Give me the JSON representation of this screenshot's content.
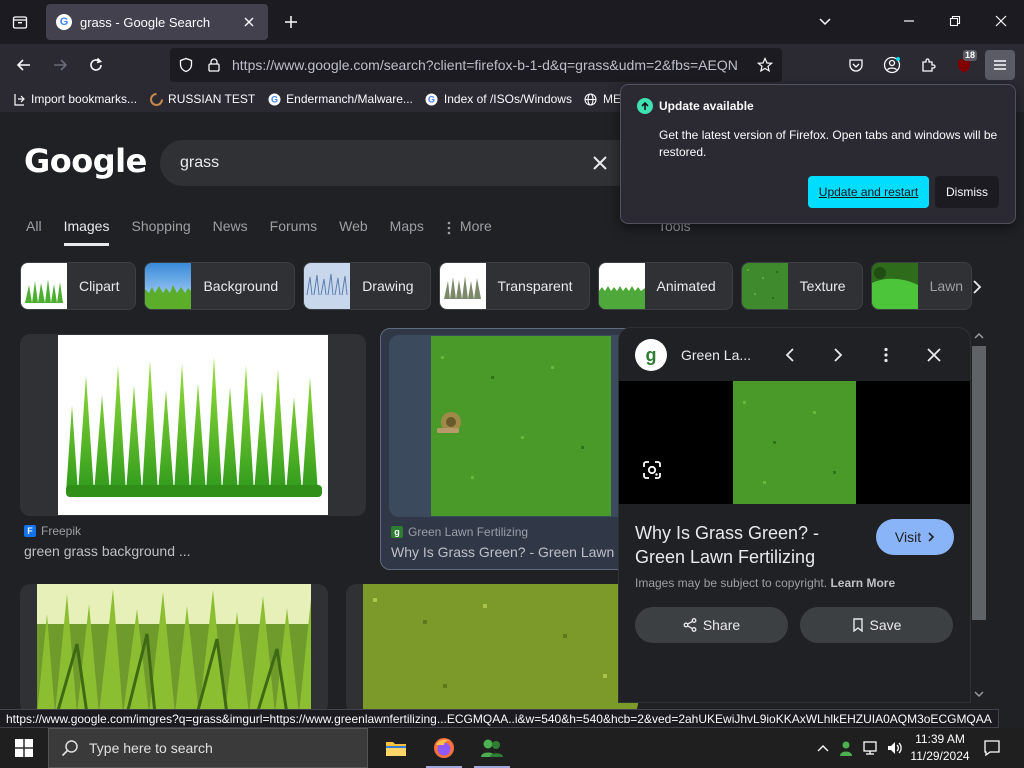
{
  "browser": {
    "tab_title": "grass - Google Search",
    "url_host": "https://www.google.com",
    "url_rest": "/search?client=firefox-b-1-d&q=grass&udm=2&fbs=AEQN",
    "notif_badge": "18"
  },
  "bookmarks": [
    {
      "label": "Import bookmarks..."
    },
    {
      "label": "RUSSIAN TEST"
    },
    {
      "label": "Endermanch/Malware..."
    },
    {
      "label": "Index of /ISOs/Windows"
    },
    {
      "label": "MEN"
    }
  ],
  "google": {
    "logo": "Google",
    "query": "grass",
    "tabs": [
      "All",
      "Images",
      "Shopping",
      "News",
      "Forums",
      "Web",
      "Maps",
      "More"
    ],
    "tools": "Tools",
    "chips": [
      "Clipart",
      "Background",
      "Drawing",
      "Transparent",
      "Animated",
      "Texture",
      "Lawn"
    ]
  },
  "results": [
    {
      "source": "Freepik",
      "title": "green grass background ..."
    },
    {
      "source": "Green Lawn Fertilizing",
      "title": "Why Is Grass Green? - Green Lawn"
    }
  ],
  "preview": {
    "site": "Green La...",
    "logo_letter": "g",
    "title": "Why Is Grass Green? - Green Lawn Fertilizing",
    "visit": "Visit",
    "copyright": "Images may be subject to copyright.",
    "learn_more": "Learn More",
    "share": "Share",
    "save": "Save"
  },
  "popup": {
    "title": "Update available",
    "body": "Get the latest version of Firefox. Open tabs and windows will be restored.",
    "primary": "Update and restart",
    "secondary": "Dismiss"
  },
  "status_url": "https://www.google.com/imgres?q=grass&imgurl=https://www.greenlawnfertilizing...ECGMQAA..i&w=540&h=540&hcb=2&ved=2ahUKEwiJhvL9ioKKAxWLhlkEHZUIA0AQM3oECGMQAA",
  "taskbar": {
    "search_placeholder": "Type here to search",
    "time": "11:39 AM",
    "date": "11/29/2024"
  },
  "colors": {
    "accent": "#8ab4f8",
    "firefox_cyan": "#00ddff",
    "update_green": "#3fe1b0"
  }
}
